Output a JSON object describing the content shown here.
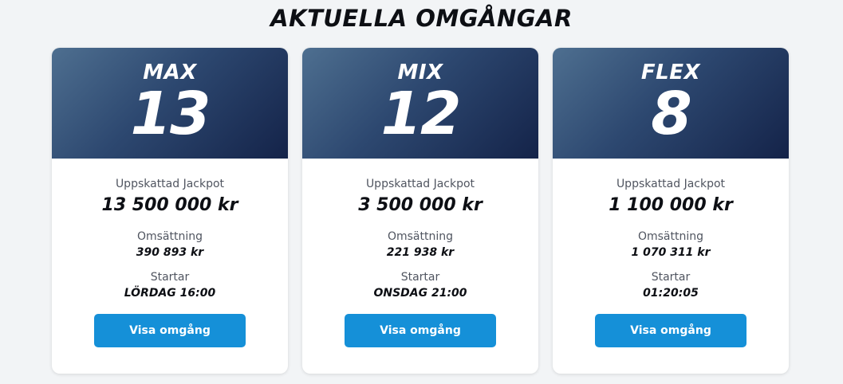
{
  "page": {
    "title": "AKTUELLA OMGÅNGAR"
  },
  "cards": [
    {
      "game": "MAX",
      "number": "13",
      "jackpot_label": "Uppskattad Jackpot",
      "jackpot_value": "13 500 000 kr",
      "turnover_label": "Omsättning",
      "turnover_value": "390 893 kr",
      "start_label": "Startar",
      "start_value": "LÖRDAG 16:00",
      "button_label": "Visa omgång"
    },
    {
      "game": "MIX",
      "number": "12",
      "jackpot_label": "Uppskattad Jackpot",
      "jackpot_value": "3 500 000 kr",
      "turnover_label": "Omsättning",
      "turnover_value": "221 938 kr",
      "start_label": "Startar",
      "start_value": "ONSDAG 21:00",
      "button_label": "Visa omgång"
    },
    {
      "game": "FLEX",
      "number": "8",
      "jackpot_label": "Uppskattad Jackpot",
      "jackpot_value": "1 100 000 kr",
      "turnover_label": "Omsättning",
      "turnover_value": "1 070 311 kr",
      "start_label": "Startar",
      "start_value": "01:20:05",
      "button_label": "Visa omgång"
    }
  ],
  "colors": {
    "background": "#f2f4f6",
    "header_gradient_start": "#4e6f90",
    "header_gradient_end": "#142349",
    "button": "#1590d8",
    "text_dark": "#0d0f14",
    "text_muted": "#505560"
  }
}
